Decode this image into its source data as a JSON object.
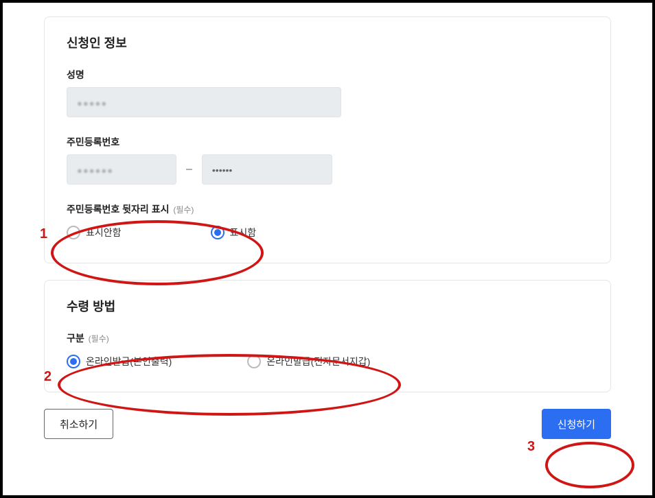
{
  "applicant": {
    "section_title": "신청인 정보",
    "name_label": "성명",
    "name_value": "●●●●●",
    "rrn_label": "주민등록번호",
    "rrn_front": "●●●●●●",
    "rrn_dash": "–",
    "rrn_back": "••••••",
    "rrn_display_label": "주민등록번호 뒷자리 표시",
    "rrn_display_req": "(필수)",
    "rrn_display_options": {
      "hide": "표시안함",
      "show": "표시함"
    },
    "rrn_display_selected": "show"
  },
  "receive": {
    "section_title": "수령 방법",
    "type_label": "구분",
    "type_req": "(필수)",
    "type_options": {
      "online_print": "온라인발급(본인출력)",
      "online_wallet": "온라인발급(전자문서지갑)"
    },
    "type_selected": "online_print"
  },
  "buttons": {
    "cancel": "취소하기",
    "submit": "신청하기"
  },
  "annotations": {
    "n1": "1",
    "n2": "2",
    "n3": "3"
  }
}
